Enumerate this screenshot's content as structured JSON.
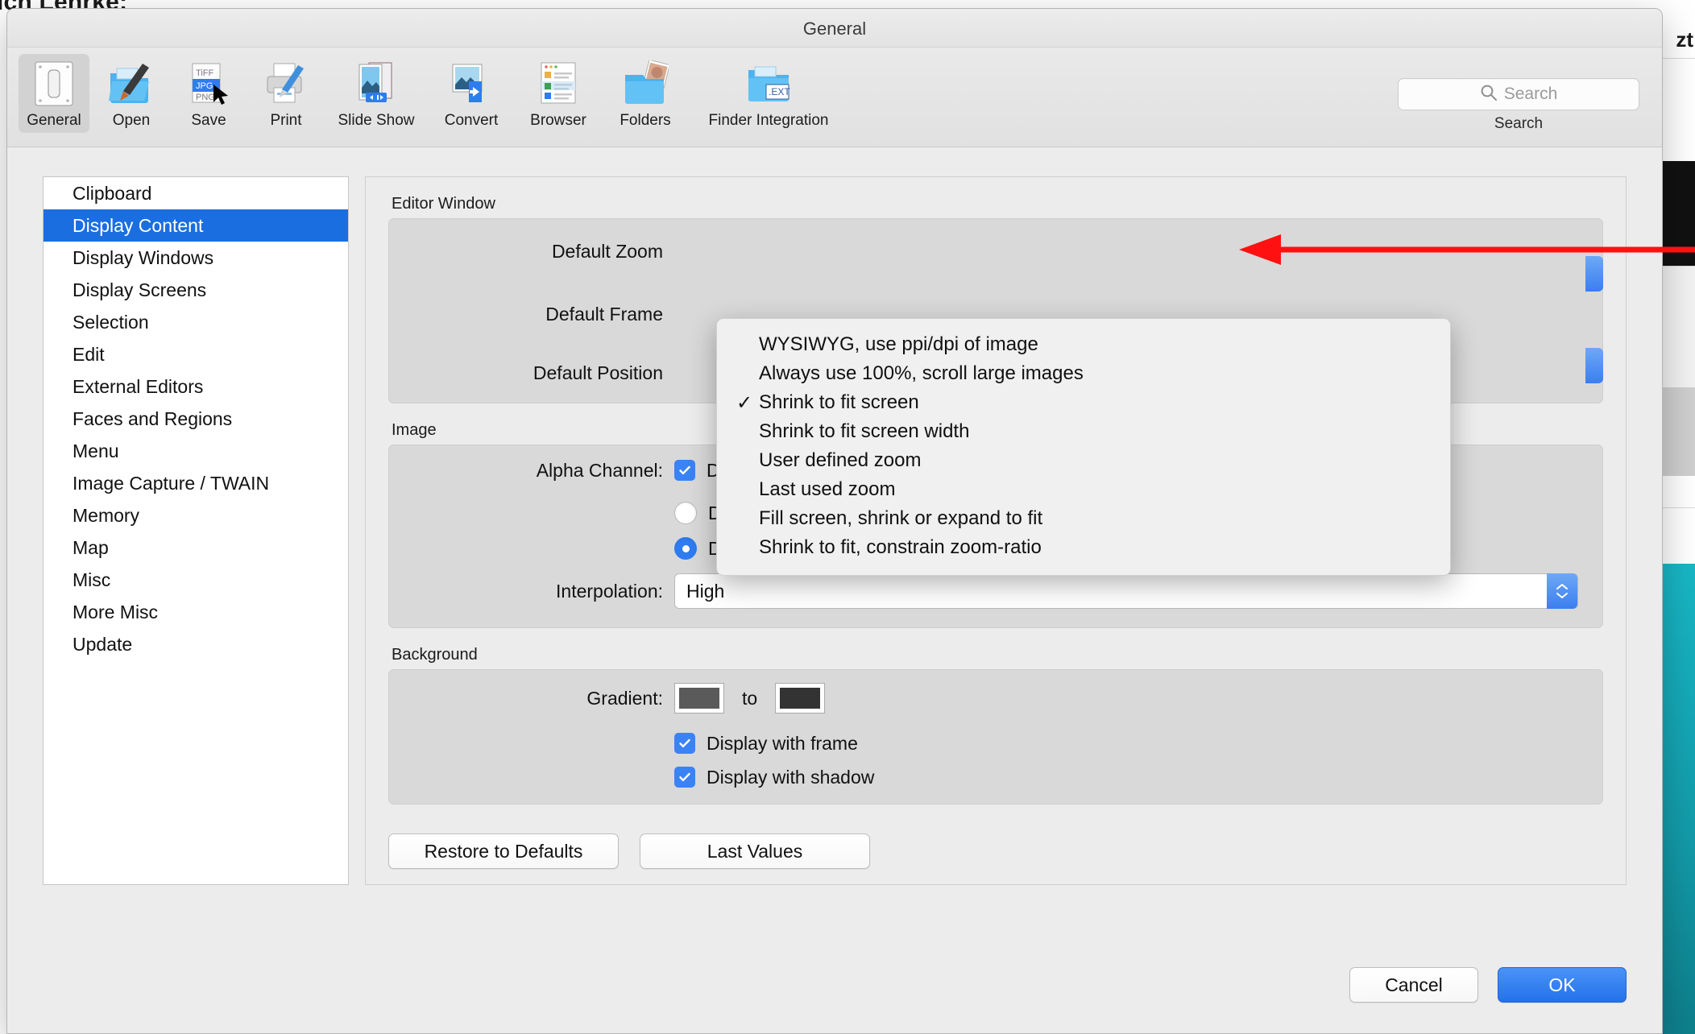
{
  "desktop": {
    "bg_text_top": "ich Lehrke;",
    "bg_text_right": "zt"
  },
  "window": {
    "title": "General"
  },
  "toolbar": {
    "items": [
      {
        "label": "General",
        "icon": "switch-panel-icon",
        "selected": true
      },
      {
        "label": "Open",
        "icon": "open-folder-brush-icon",
        "selected": false
      },
      {
        "label": "Save",
        "icon": "file-formats-icon",
        "selected": false
      },
      {
        "label": "Print",
        "icon": "printer-icon",
        "selected": false
      },
      {
        "label": "Slide Show",
        "icon": "slideshow-icon",
        "selected": false
      },
      {
        "label": "Convert",
        "icon": "convert-arrow-icon",
        "selected": false
      },
      {
        "label": "Browser",
        "icon": "browser-list-icon",
        "selected": false
      },
      {
        "label": "Folders",
        "icon": "folders-photo-icon",
        "selected": false
      },
      {
        "label": "Finder Integration",
        "icon": "finder-ext-icon",
        "selected": false
      }
    ],
    "save_icon_labels": [
      "TiFF",
      "JPG",
      "PNG"
    ],
    "finder_badge": ".EXT"
  },
  "search": {
    "placeholder": "Search",
    "caption": "Search",
    "icon": "search-icon"
  },
  "sidebar": {
    "items": [
      {
        "label": "Clipboard",
        "active": false
      },
      {
        "label": "Display Content",
        "active": true
      },
      {
        "label": "Display Windows",
        "active": false
      },
      {
        "label": "Display Screens",
        "active": false
      },
      {
        "label": "Selection",
        "active": false
      },
      {
        "label": "Edit",
        "active": false
      },
      {
        "label": "External Editors",
        "active": false
      },
      {
        "label": "Faces and Regions",
        "active": false
      },
      {
        "label": "Menu",
        "active": false
      },
      {
        "label": "Image Capture / TWAIN",
        "active": false
      },
      {
        "label": "Memory",
        "active": false
      },
      {
        "label": "Map",
        "active": false
      },
      {
        "label": "Misc",
        "active": false
      },
      {
        "label": "More Misc",
        "active": false
      },
      {
        "label": "Update",
        "active": false
      }
    ]
  },
  "editor_window": {
    "group_label": "Editor Window",
    "rows": [
      {
        "label": "Default Zoom"
      },
      {
        "label": "Default Frame"
      },
      {
        "label": "Default Position"
      }
    ]
  },
  "zoom_menu": {
    "selected": "Shrink to fit screen",
    "check_glyph": "✓",
    "options": [
      {
        "label": "WYSIWYG, use ppi/dpi of image",
        "checked": false
      },
      {
        "label": "Always use 100%, scroll large images",
        "checked": false
      },
      {
        "label": "Shrink to fit screen",
        "checked": true
      },
      {
        "label": "Shrink to fit screen width",
        "checked": false
      },
      {
        "label": "User defined zoom",
        "checked": false
      },
      {
        "label": "Last used zoom",
        "checked": false
      },
      {
        "label": "Fill screen, shrink or expand to fit",
        "checked": false
      },
      {
        "label": "Shrink to fit, constrain zoom-ratio",
        "checked": false
      }
    ]
  },
  "image_section": {
    "group_label": "Image",
    "alpha_label": "Alpha Channel:",
    "display_with_mask": {
      "label": "Display with mask",
      "checked": true
    },
    "alpha_radios": [
      {
        "label": "Display alpha channel black for transparent parts",
        "selected": false
      },
      {
        "label": "Display alpha channel white for transparent parts",
        "selected": true
      }
    ],
    "interpolation_label": "Interpolation:",
    "interpolation_value": "High"
  },
  "background_section": {
    "group_label": "Background",
    "gradient_label": "Gradient:",
    "gradient_to": "to",
    "gradient_from_color": "#5a5a5a",
    "gradient_to_color": "#333333",
    "checkboxes": [
      {
        "label": "Display with frame",
        "checked": true
      },
      {
        "label": "Display with shadow",
        "checked": true
      }
    ]
  },
  "footer_buttons": {
    "restore_to_defaults": "Restore to Defaults",
    "last_values": "Last Values"
  },
  "dialog_buttons": {
    "cancel": "Cancel",
    "ok": "OK"
  },
  "annotation": {
    "arrow_color": "#ff1111",
    "direction": "left"
  },
  "colors": {
    "accent_blue": "#1a6ee0",
    "checkbox_blue": "#3b82f6",
    "primary_button_blue": "#2272ea",
    "window_bg": "#ececec",
    "group_bg": "#d9d9d9"
  }
}
